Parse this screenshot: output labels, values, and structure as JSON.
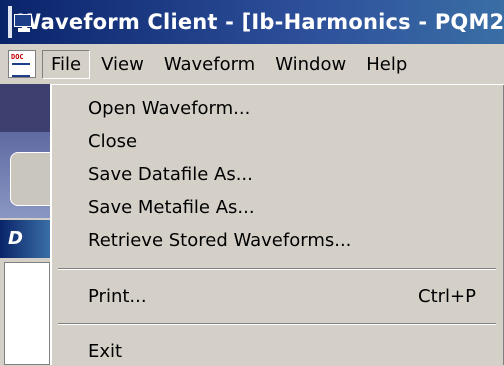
{
  "window": {
    "title": "Waveform Client - [Ib-Harmonics - PQM2"
  },
  "menubar": {
    "doc_icon_label": "DOC",
    "items": [
      {
        "label": "File"
      },
      {
        "label": "View"
      },
      {
        "label": "Waveform"
      },
      {
        "label": "Window"
      },
      {
        "label": "Help"
      }
    ]
  },
  "background": {
    "header_letter": "D"
  },
  "file_menu": {
    "items": [
      {
        "label": "Open Waveform...",
        "shortcut": ""
      },
      {
        "label": "Close",
        "shortcut": ""
      },
      {
        "label": "Save Datafile As...",
        "shortcut": ""
      },
      {
        "label": "Save Metafile As...",
        "shortcut": ""
      },
      {
        "label": "Retrieve Stored Waveforms...",
        "shortcut": ""
      },
      {
        "label": "Print...",
        "shortcut": "Ctrl+P"
      },
      {
        "label": "Exit",
        "shortcut": ""
      }
    ]
  },
  "colors": {
    "title_bar": "#0a246a",
    "menu_bg": "#d4d0c8"
  }
}
